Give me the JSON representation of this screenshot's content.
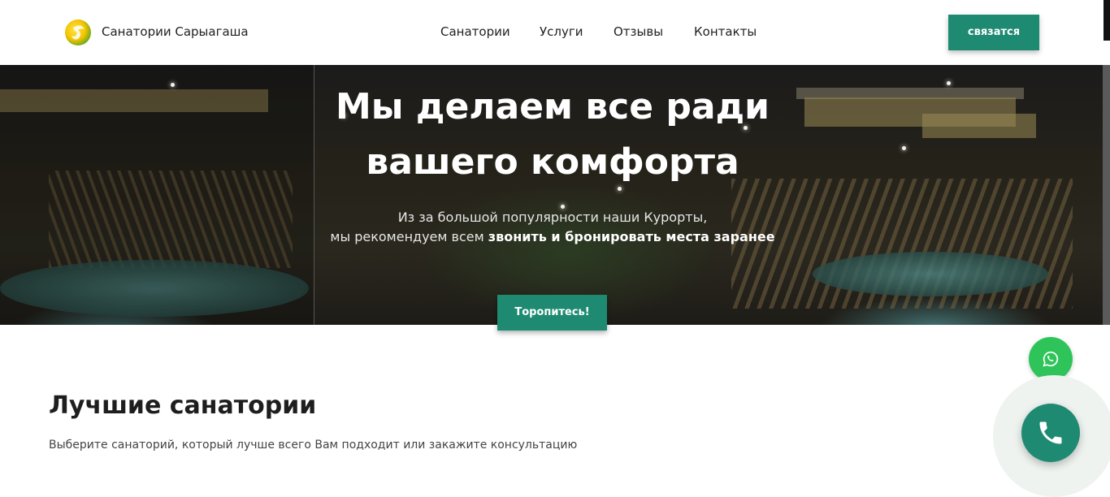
{
  "header": {
    "brand": "Санатории Сарыагаша",
    "nav": [
      "Санатории",
      "Услуги",
      "Отзывы",
      "Контакты"
    ],
    "contact_button": "связатся"
  },
  "hero": {
    "title_line1": "Мы делаем все ради",
    "title_line2": "вашего комфорта",
    "subtitle_line1": "Из за большой популярности наши Курорты,",
    "subtitle_line2_prefix": "мы рекомендуем всем ",
    "subtitle_line2_bold": "звонить и бронировать места заранее",
    "cta_button": "Торопитесь!"
  },
  "section": {
    "title": "Лучшие санатории",
    "subtitle": "Выберите санаторий, который лучше всего Вам подходит или закажите консультацию"
  },
  "icons": {
    "logo": "sanatorium-logo-icon",
    "whatsapp": "whatsapp-icon",
    "phone": "phone-icon"
  },
  "colors": {
    "accent": "#1f8a72",
    "whatsapp": "#2ec45a"
  }
}
